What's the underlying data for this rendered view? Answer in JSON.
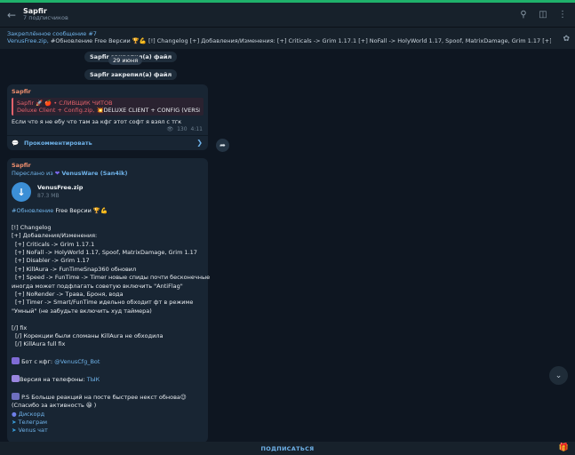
{
  "colors": {
    "background": "#0e1621",
    "panel": "#17212b",
    "bubble": "#182533",
    "accent": "#6fb3ea",
    "sender": "#f08f6e",
    "quote_red": "#e2626b",
    "top_line": "#1fb16b"
  },
  "header": {
    "back_icon": "arrow-left-icon",
    "title": "Sapfir",
    "subtitle": "7 подписчиков",
    "icons": [
      "search-icon",
      "sidebar-toggle-icon",
      "more-vertical-icon"
    ]
  },
  "pinned": {
    "title": "Закреплённое сообщение #7",
    "file_label": "VenusFree.zip,",
    "text": "#Обновление Free Версии 🏆💪 [!] Changelog [+] Добавления/Изменения: [+] Criticals -> Grim 1.17.1 [+] NoFall -> HolyWorld 1.17, Spoof, MatrixDamage, Grim 1.17 [+] Disable...",
    "icon": "pin-icon"
  },
  "service": {
    "pinned1": "Sapfir закрепил(а) файл",
    "pinned2": "Sapfir закрепил(а) файл",
    "date": "29 июня"
  },
  "message1": {
    "sender": "Sapfir",
    "reply_title": "Sapfir 🚀 🍎 • СЛИВЩИК ЧИТОВ",
    "reply_file": "Deluxe Client + Config.zip,",
    "reply_text": "💥DELUXE CLIENT + CONFIG (VERSIO...",
    "text": "Если что я не ебу что там за кфг этот софт я взял с тгк",
    "views": "130",
    "time": "4:11",
    "comment_label": "Прокомментировать",
    "comment_icon": "comment-icon",
    "arrow_icon": "chevron-right-icon",
    "share_icon": "share-icon"
  },
  "message2": {
    "sender": "Sapfir",
    "forwarded_prefix": "Переслано из",
    "forwarded_from": "VenusWare (San4ik)",
    "file_name": "VenusFree.zip",
    "file_size": "87.3 MB",
    "download_icon": "download-icon",
    "hashtag": "#Обновление",
    "headline": "Free Версии 🏆💪",
    "lines": [
      "[!] Changelog",
      "[+] Добавления/Изменения:",
      "  [+] Criticals -> Grim 1.17.1",
      "  [+] NoFall -> HolyWorld 1.17, Spoof, MatrixDamage, Grim 1.17",
      "  [+] Disabler -> Grim 1.17",
      "  [+] KillAura -> FunTimeSnap360 обновил",
      "  [+] Speed -> FunTime -> Timer новые спиды почти бесконечные",
      "иногда может подфлагать советую включить \"AntiFlag\"",
      "  [+] NoRender -> Трава, Броня, вода",
      "  [+] Timer -> Smart/FunTime идельно обходит фт в режиме",
      "\"Умный\" (не забудьте включить худ таймера)",
      "",
      "[/] fix",
      "  [/] Корекции были сломаны KillAura не обходила",
      "  [/] KillAura full fix"
    ],
    "bot_prefix": "Бот с кфг:",
    "bot_link": "@VenusCfg_Bot",
    "phone_prefix": "Версия на телефоны:",
    "phone_link": "ТЫК",
    "ps_line": "P.S Больше реакций на посте быстрее некст обнова😉",
    "thanks_line": "(Спасибо за активность 😀 )",
    "links": [
      "Дискорд",
      "Телеграм",
      "Venus чат"
    ]
  },
  "scroll_down_icon": "chevron-down-icon",
  "bottom": {
    "subscribe_label": "ПОДПИСАТЬСЯ",
    "gift_icon": "gift-icon"
  }
}
